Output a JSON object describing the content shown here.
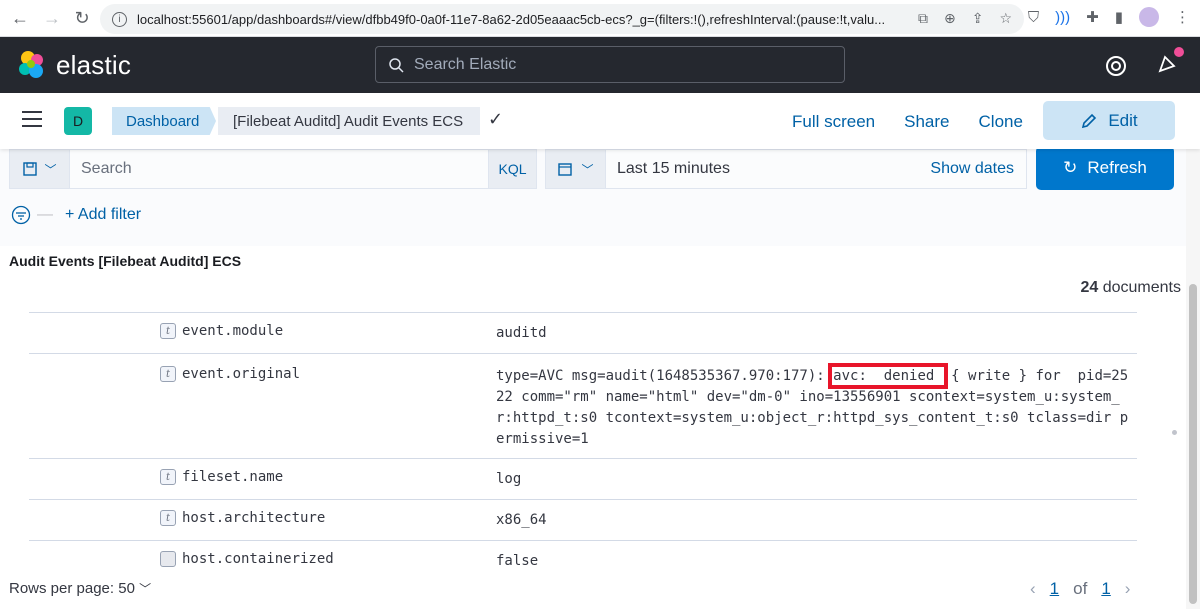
{
  "browser": {
    "url": "localhost:55601/app/dashboards#/view/dfbb49f0-0a0f-11e7-8a62-2d05eaaac5cb-ecs?_g=(filters:!(),refreshInterval:(pause:!t,valu..."
  },
  "header": {
    "logo_text": "elastic",
    "search_placeholder": "Search Elastic"
  },
  "breadcrumbs": {
    "space_initial": "D",
    "items": [
      "Dashboard",
      "[Filebeat Auditd] Audit Events ECS"
    ]
  },
  "actions": {
    "full_screen": "Full screen",
    "share": "Share",
    "clone": "Clone",
    "edit": "Edit"
  },
  "query_bar": {
    "search_placeholder": "Search",
    "language": "KQL",
    "date_range": "Last 15 minutes",
    "show_dates": "Show dates",
    "refresh": "Refresh",
    "add_filter": "+ Add filter"
  },
  "panel": {
    "title": "Audit Events [Filebeat Auditd] ECS",
    "doc_count": "24",
    "doc_count_label": "documents",
    "rows": [
      {
        "type": "t",
        "field": "event.module",
        "value": "auditd"
      },
      {
        "type": "t",
        "field": "event.original",
        "value_pre": "type=AVC msg=audit(1648535367.970:177): ",
        "value_highlight": "avc:  denied ",
        "value_post": " { write } for  pid=2522 comm=\"rm\" name=\"html\" dev=\"dm-0\" ino=13556901 scontext=system_u:system_r:httpd_t:s0 tcontext=system_u:object_r:httpd_sys_content_t:s0 tclass=dir permissive=1"
      },
      {
        "type": "t",
        "field": "fileset.name",
        "value": "log"
      },
      {
        "type": "t",
        "field": "host.architecture",
        "value": "x86_64"
      },
      {
        "type": "b",
        "field": "host.containerized",
        "value": "false"
      }
    ]
  },
  "footer": {
    "rows_per_page": "Rows per page: 50",
    "current_page": "1",
    "of_label": "of",
    "total_pages": "1"
  }
}
